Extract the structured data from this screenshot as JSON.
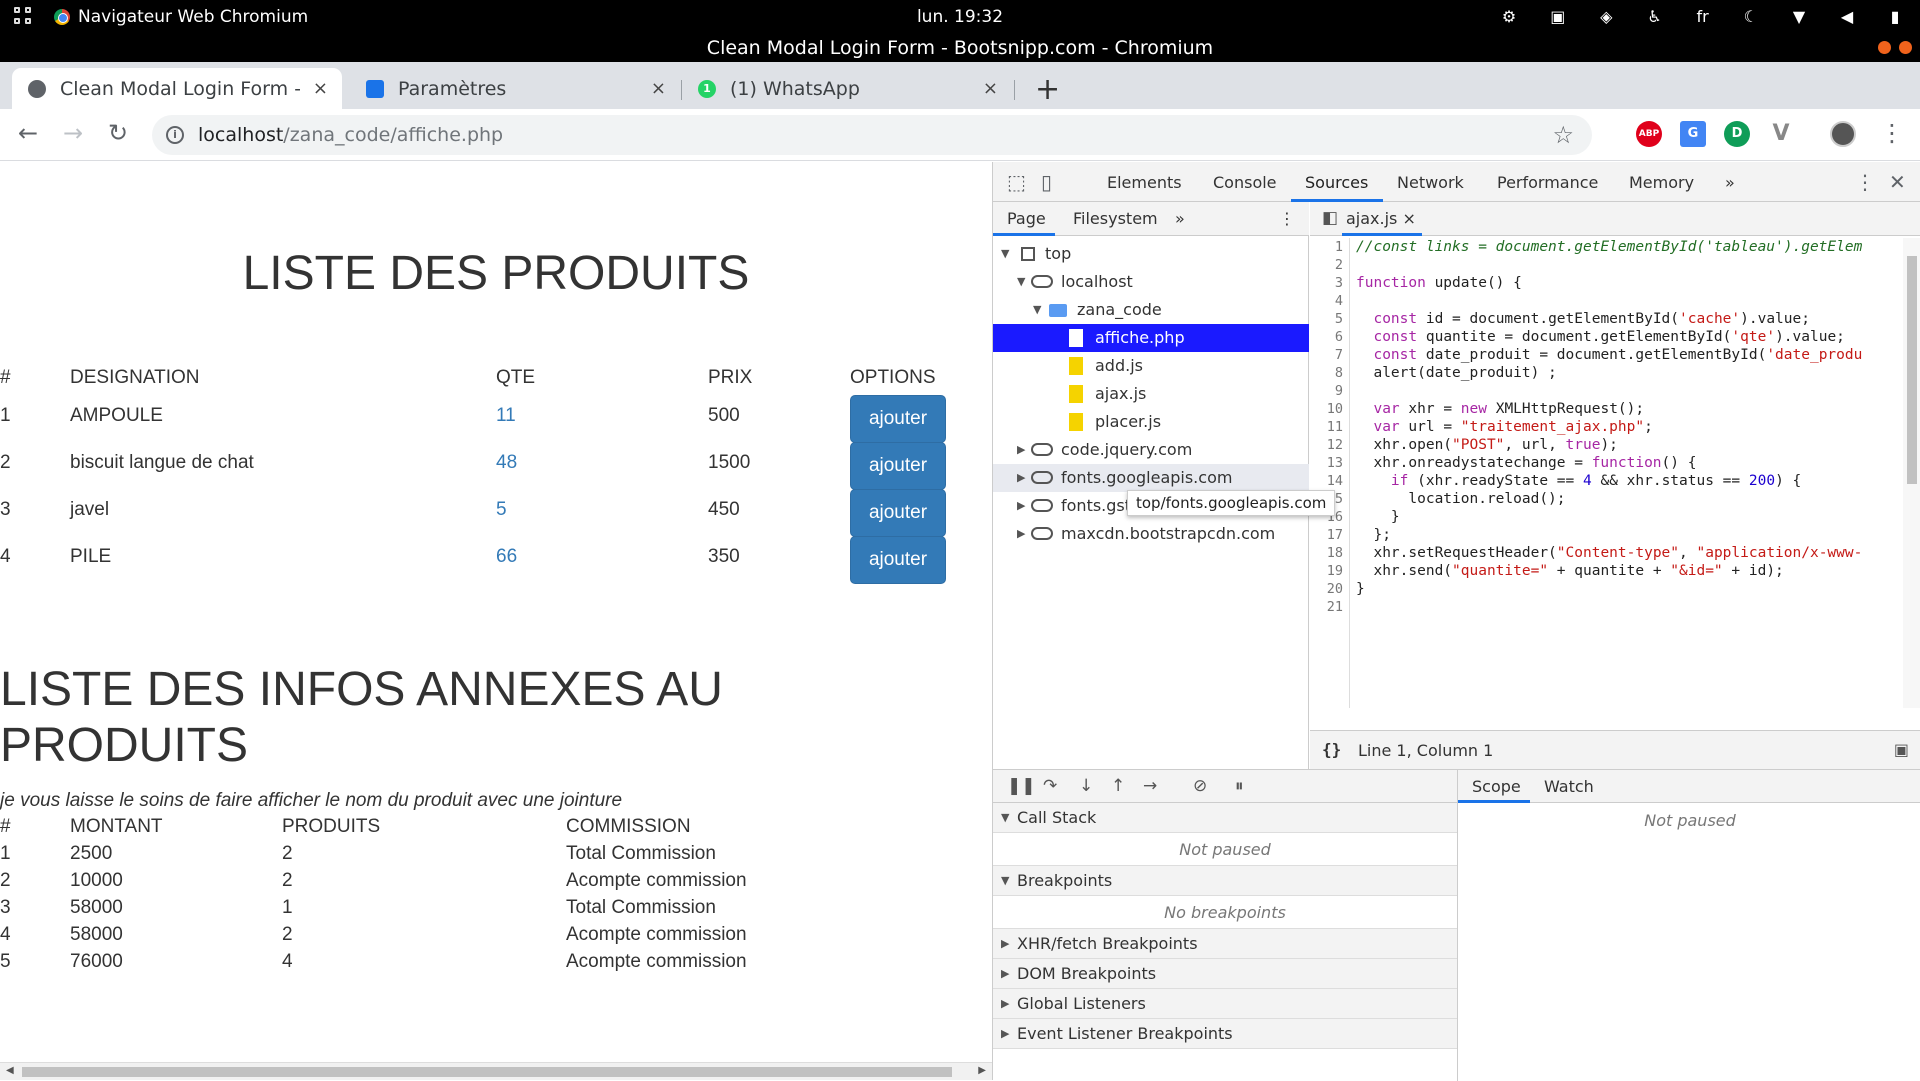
{
  "topbar": {
    "app_menu": "Navigateur Web Chromium",
    "clock": "lun. 19:32",
    "lang": "fr"
  },
  "window": {
    "title": "Clean Modal Login Form - Bootsnipp.com - Chromium"
  },
  "tabs": [
    {
      "title": "Clean Modal Login Form -",
      "icon": "globe-icon",
      "close": "×"
    },
    {
      "title": "Paramètres",
      "icon": "gear-icon",
      "close": "×"
    },
    {
      "title": "(1) WhatsApp",
      "icon": "whatsapp-icon",
      "badge": "1",
      "close": "×"
    }
  ],
  "new_tab": "+",
  "omnibox": {
    "host": "localhost",
    "path": "/zana_code/affiche.php"
  },
  "extensions": [
    {
      "name": "adblock-icon",
      "label": "ABP",
      "color": "#e0001b"
    },
    {
      "name": "translate-icon",
      "label": "G",
      "color": "#4285f4"
    },
    {
      "name": "extension-green-icon",
      "label": "D",
      "color": "#0f9d58"
    },
    {
      "name": "vue-devtools-icon",
      "label": "V",
      "color": "#888888"
    }
  ],
  "page": {
    "title1": "LISTE DES PRODUITS",
    "products": {
      "headers": [
        "#",
        "DESIGNATION",
        "QTE",
        "PRIX",
        "OPTIONS"
      ],
      "rows": [
        [
          "1",
          "AMPOULE",
          "11",
          "500"
        ],
        [
          "2",
          "biscuit langue de chat",
          "48",
          "1500"
        ],
        [
          "3",
          "javel",
          "5",
          "450"
        ],
        [
          "4",
          "PILE",
          "66",
          "350"
        ]
      ],
      "button_label": "ajouter"
    },
    "title2": "LISTE DES INFOS ANNEXES AU PRODUITS",
    "note": "je vous laisse le soins de faire afficher le nom du produit avec une jointure",
    "infos": {
      "headers": [
        "#",
        "MONTANT",
        "PRODUITS",
        "COMMISSION"
      ],
      "rows": [
        [
          "1",
          "2500",
          "2",
          "Total Commission"
        ],
        [
          "2",
          "10000",
          "2",
          "Acompte commission"
        ],
        [
          "3",
          "58000",
          "1",
          "Total Commission"
        ],
        [
          "4",
          "58000",
          "2",
          "Acompte commission"
        ],
        [
          "5",
          "76000",
          "4",
          "Acompte commission"
        ]
      ]
    }
  },
  "devtools": {
    "tabs": [
      "Elements",
      "Console",
      "Sources",
      "Network",
      "Performance",
      "Memory"
    ],
    "active_tab": "Sources",
    "more": "»",
    "navigator_tabs": [
      "Page",
      "Filesystem"
    ],
    "tree": [
      "top",
      "localhost",
      "zana_code",
      "affiche.php",
      "add.js",
      "ajax.js",
      "placer.js",
      "code.jquery.com",
      "fonts.googleapis.com",
      "fonts.gst",
      "maxcdn.bootstrapcdn.com"
    ],
    "tooltip": "top/fonts.googleapis.com",
    "editor_file": "ajax.js",
    "code": [
      "//const links = document.getElementById('tableau').getElem",
      "",
      "function update() {",
      "",
      "  const id = document.getElementById('cache').value;",
      "  const quantite = document.getElementById('qte').value;",
      "  const date_produit = document.getElementById('date_produ",
      "  alert(date_produit) ;",
      "",
      "  var xhr = new XMLHttpRequest();",
      "  var url = \"traitement_ajax.php\";",
      "  xhr.open(\"POST\", url, true);",
      "  xhr.onreadystatechange = function() {",
      "    if (xhr.readyState == 4 && xhr.status == 200) {",
      "      location.reload();",
      "    }",
      "  };",
      "  xhr.setRequestHeader(\"Content-type\", \"application/x-www-",
      "  xhr.send(\"quantite=\" + quantite + \"&id=\" + id);",
      "}",
      ""
    ],
    "status": {
      "braces": "{}",
      "position": "Line 1, Column 1"
    },
    "sections": {
      "call_stack": "Call Stack",
      "not_paused": "Not paused",
      "breakpoints": "Breakpoints",
      "no_breakpoints": "No breakpoints",
      "xhr": "XHR/fetch Breakpoints",
      "dom": "DOM Breakpoints",
      "global": "Global Listeners",
      "event": "Event Listener Breakpoints"
    },
    "scope_tabs": [
      "Scope",
      "Watch"
    ],
    "scope_empty": "Not paused"
  }
}
